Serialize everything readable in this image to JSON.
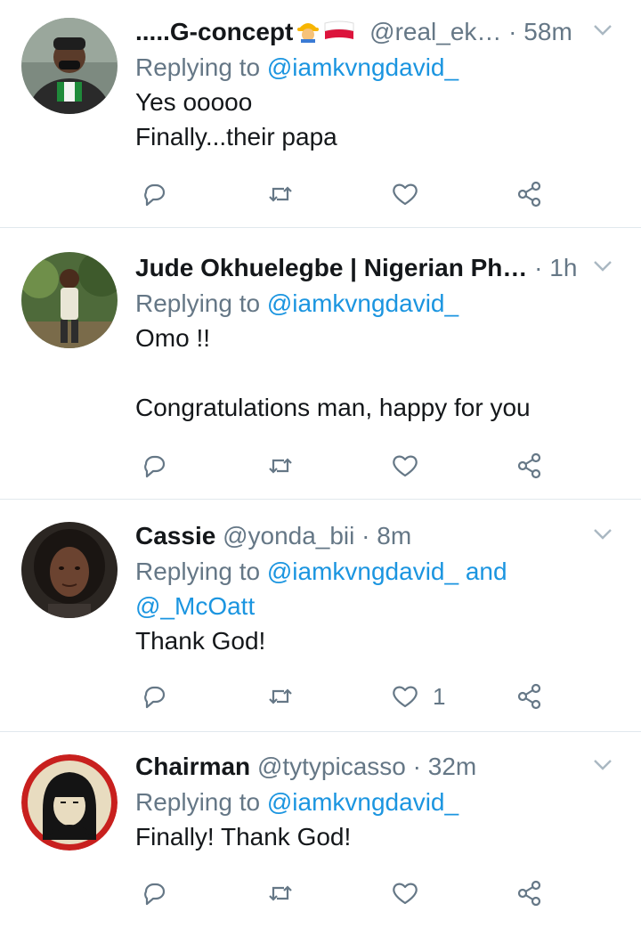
{
  "colors": {
    "text": "#14171a",
    "muted": "#657786",
    "link": "#1b95e0",
    "divider": "#e1e8ed"
  },
  "tweets": [
    {
      "name": ".....G-concept",
      "handle": "@real_ek…",
      "dot": " · ",
      "time": "58m",
      "reply_prefix": "Replying to ",
      "mentions": "@iamkvngdavid_",
      "body": "Yes ooooo\nFinally...their papa",
      "like_count": "",
      "icons": [
        "construction-worker-emoji",
        "poland-flag-emoji"
      ]
    },
    {
      "name": "Jude Okhuelegbe | Nigerian Ph…",
      "handle": "",
      "dot": " · ",
      "time": "1h",
      "reply_prefix": "Replying to ",
      "mentions": "@iamkvngdavid_",
      "body": "Omo !!\n\nCongratulations man, happy for you",
      "like_count": ""
    },
    {
      "name": "Cassie",
      "handle": "@yonda_bii",
      "dot": " · ",
      "time": "8m",
      "reply_prefix": "Replying to ",
      "mentions": "@iamkvngdavid_ and @_McOatt",
      "body": "Thank God!",
      "like_count": "1"
    },
    {
      "name": "Chairman",
      "handle": "@tytypicasso",
      "dot": " · ",
      "time": "32m",
      "reply_prefix": "Replying to ",
      "mentions": "@iamkvngdavid_",
      "body": "Finally! Thank God!",
      "like_count": ""
    }
  ],
  "action_icons": [
    "reply-icon",
    "retweet-icon",
    "like-icon",
    "share-icon"
  ]
}
